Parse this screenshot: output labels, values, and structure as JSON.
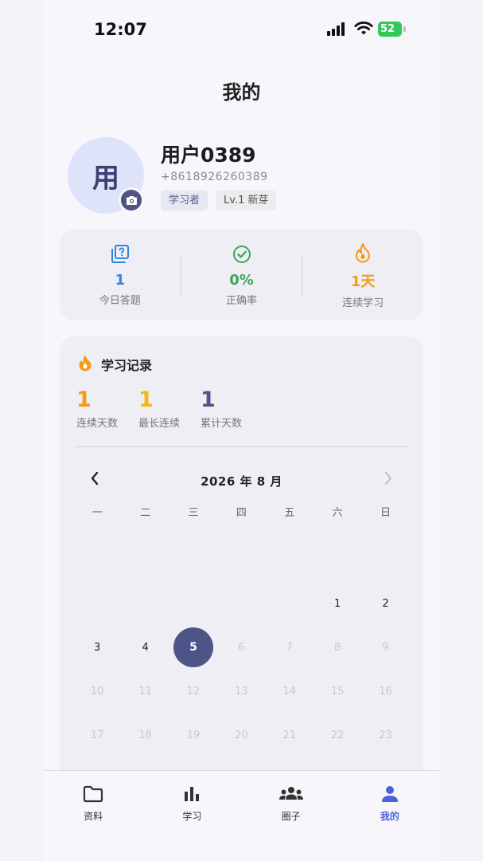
{
  "status_bar": {
    "time": "12:07",
    "battery": "52"
  },
  "page": {
    "title": "我的"
  },
  "profile": {
    "avatar_char": "用",
    "name": "用户0389",
    "phone": "+8618926260389",
    "tags": [
      "学习者",
      "Lv.1 新芽"
    ]
  },
  "stats": [
    {
      "value": "1",
      "label": "今日答题",
      "icon": "question-cards-icon",
      "color": "#2f86e0"
    },
    {
      "value": "0%",
      "label": "正确率",
      "icon": "check-circle-icon",
      "color": "#3aa55a"
    },
    {
      "value": "1天",
      "label": "连续学习",
      "icon": "flame-icon",
      "color": "#f39b11"
    }
  ],
  "record": {
    "title": "学习记录",
    "streaks": [
      {
        "value": "1",
        "label": "连续天数",
        "color": "#f39b11"
      },
      {
        "value": "1",
        "label": "最长连续",
        "color": "#f5b80f"
      },
      {
        "value": "1",
        "label": "累计天数",
        "color": "#4d5488"
      }
    ]
  },
  "calendar": {
    "month_label": "2026 年 8 月",
    "weekdays": [
      "一",
      "二",
      "三",
      "四",
      "五",
      "六",
      "日"
    ],
    "weeks": [
      [
        "",
        "",
        "",
        "",
        "",
        "1",
        "2"
      ],
      [
        "3",
        "4",
        "5",
        "6",
        "7",
        "8",
        "9"
      ],
      [
        "10",
        "11",
        "12",
        "13",
        "14",
        "15",
        "16"
      ],
      [
        "17",
        "18",
        "19",
        "20",
        "21",
        "22",
        "23"
      ]
    ],
    "today": "5"
  },
  "tabs": [
    {
      "label": "资料",
      "icon": "folder-icon",
      "selected": false
    },
    {
      "label": "学习",
      "icon": "bar-chart-icon",
      "selected": false
    },
    {
      "label": "圈子",
      "icon": "group-icon",
      "selected": false
    },
    {
      "label": "我的",
      "icon": "person-icon",
      "selected": true
    }
  ],
  "colors": {
    "accent": "#4a65d8",
    "today": "#4d5488"
  }
}
